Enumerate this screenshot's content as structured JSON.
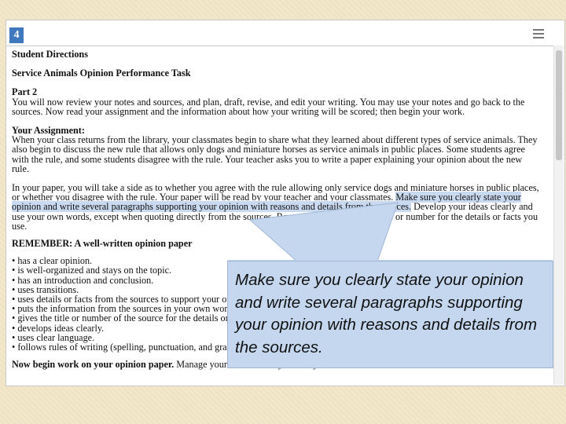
{
  "question_number": "4",
  "heading": "Student Directions",
  "task_title": "Service Animals Opinion Performance Task",
  "part_title": "Part 2",
  "part_lines": [
    "You will now review your notes and sources, and plan, draft, revise, and edit your writing. You may use your notes and go back to the",
    "sources. Now read your assignment and the information about how your writing will be scored; then begin your work."
  ],
  "assignment_title": "Your Assignment:",
  "assignment_lines": [
    "When your class returns from the library, your classmates begin to share what they learned about different types of service animals. They",
    "also begin to discuss the new rule that allows only dogs and miniature horses as service animals in public places. Some students agree",
    "with the rule, and some students disagree with the rule. Your teacher asks you to write a paper explaining your opinion about the new",
    "rule."
  ],
  "paper_para": {
    "line1": "In your paper, you will take a side as to whether you agree with the rule allowing only service dogs and miniature horses in public places,",
    "line2_plain": "or whether you disagree with the rule. Your paper will be read by your teacher and your classmates. ",
    "line2_hl": "Make sure you clearly state your",
    "line3_hl": "opinion and write several paragraphs supporting your opinion with reasons and details from the sources.",
    "line3_plain": " Develop your ideas clearly and",
    "line4": "use your own words, except when quoting directly from the sources. Be sure to give the source title or number for the details or facts you",
    "line5": "use."
  },
  "remember_title": "REMEMBER: A well-written opinion paper",
  "bullets": [
    "has a clear opinion.",
    "is well-organized and stays on the topic.",
    "has an introduction and conclusion.",
    "uses transitions.",
    "uses details or facts from the sources to support your opinion.",
    "puts the information from the sources in your own words.",
    "gives the title or number of the source for the details or facts.",
    "develops ideas clearly.",
    "uses clear language.",
    "follows rules of writing (spelling, punctuation, and grammar)."
  ],
  "final_line": {
    "bold": "Now begin work on your opinion paper.",
    "plain": " Manage your time carefully so that you can"
  },
  "callout_text": "Make sure you clearly state your opinion and write several paragraphs supporting your opinion with reasons and details from the sources.",
  "colors": {
    "question_badge": "#3f78bd",
    "highlight": "#c9d9ef",
    "callout_bg": "#c4d7ee",
    "background": "#efe3c3"
  }
}
